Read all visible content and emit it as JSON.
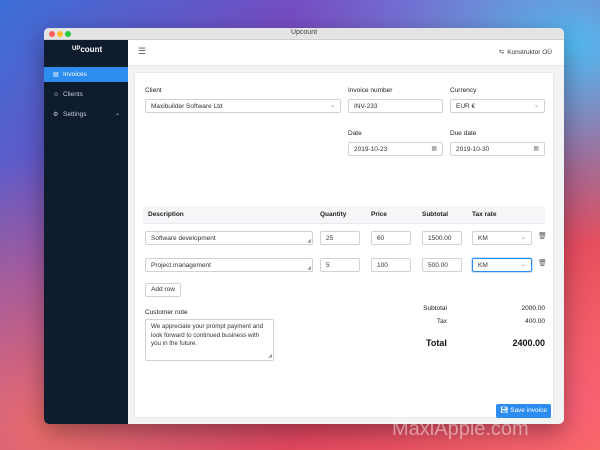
{
  "window": {
    "title": "Upcount"
  },
  "brand": {
    "mark": "UP",
    "text": "count"
  },
  "sidebar": {
    "items": [
      {
        "label": "Invoices",
        "icon": "document-icon"
      },
      {
        "label": "Clients",
        "icon": "users-icon"
      },
      {
        "label": "Settings",
        "icon": "gear-icon"
      }
    ]
  },
  "topbar": {
    "company": "Konstruktor OÜ"
  },
  "form": {
    "client_label": "Client",
    "client_value": "Maxibuilder Software Ltd",
    "invoice_number_label": "Invoice number",
    "invoice_number_value": "INV-233",
    "currency_label": "Currency",
    "currency_value": "EUR €",
    "date_label": "Date",
    "date_value": "2019-10-23",
    "due_date_label": "Due date",
    "due_date_value": "2019-10-30"
  },
  "table": {
    "headers": [
      "Description",
      "Quantity",
      "Price",
      "Subtotal",
      "Tax rate"
    ],
    "rows": [
      {
        "description": "Software development",
        "quantity": "25",
        "price": "60",
        "subtotal": "1500.00",
        "tax": "KM"
      },
      {
        "description": "Project management",
        "quantity": "5",
        "price": "100",
        "subtotal": "500.00",
        "tax": "KM"
      }
    ],
    "add_row_label": "Add row"
  },
  "note": {
    "label": "Customer note",
    "text": "We appreciate your prompt payment and look forward to continued business with you in the future."
  },
  "summary": {
    "subtotal_label": "Subtotal",
    "subtotal_value": "2000.00",
    "tax_label": "Tax",
    "tax_value": "400.00",
    "total_label": "Total",
    "total_value": "2400.00"
  },
  "save_label": "Save invoice",
  "watermark": "MaxiApple.com",
  "colors": {
    "accent": "#2d8cf0",
    "sidebar": "#0f1c2e"
  }
}
